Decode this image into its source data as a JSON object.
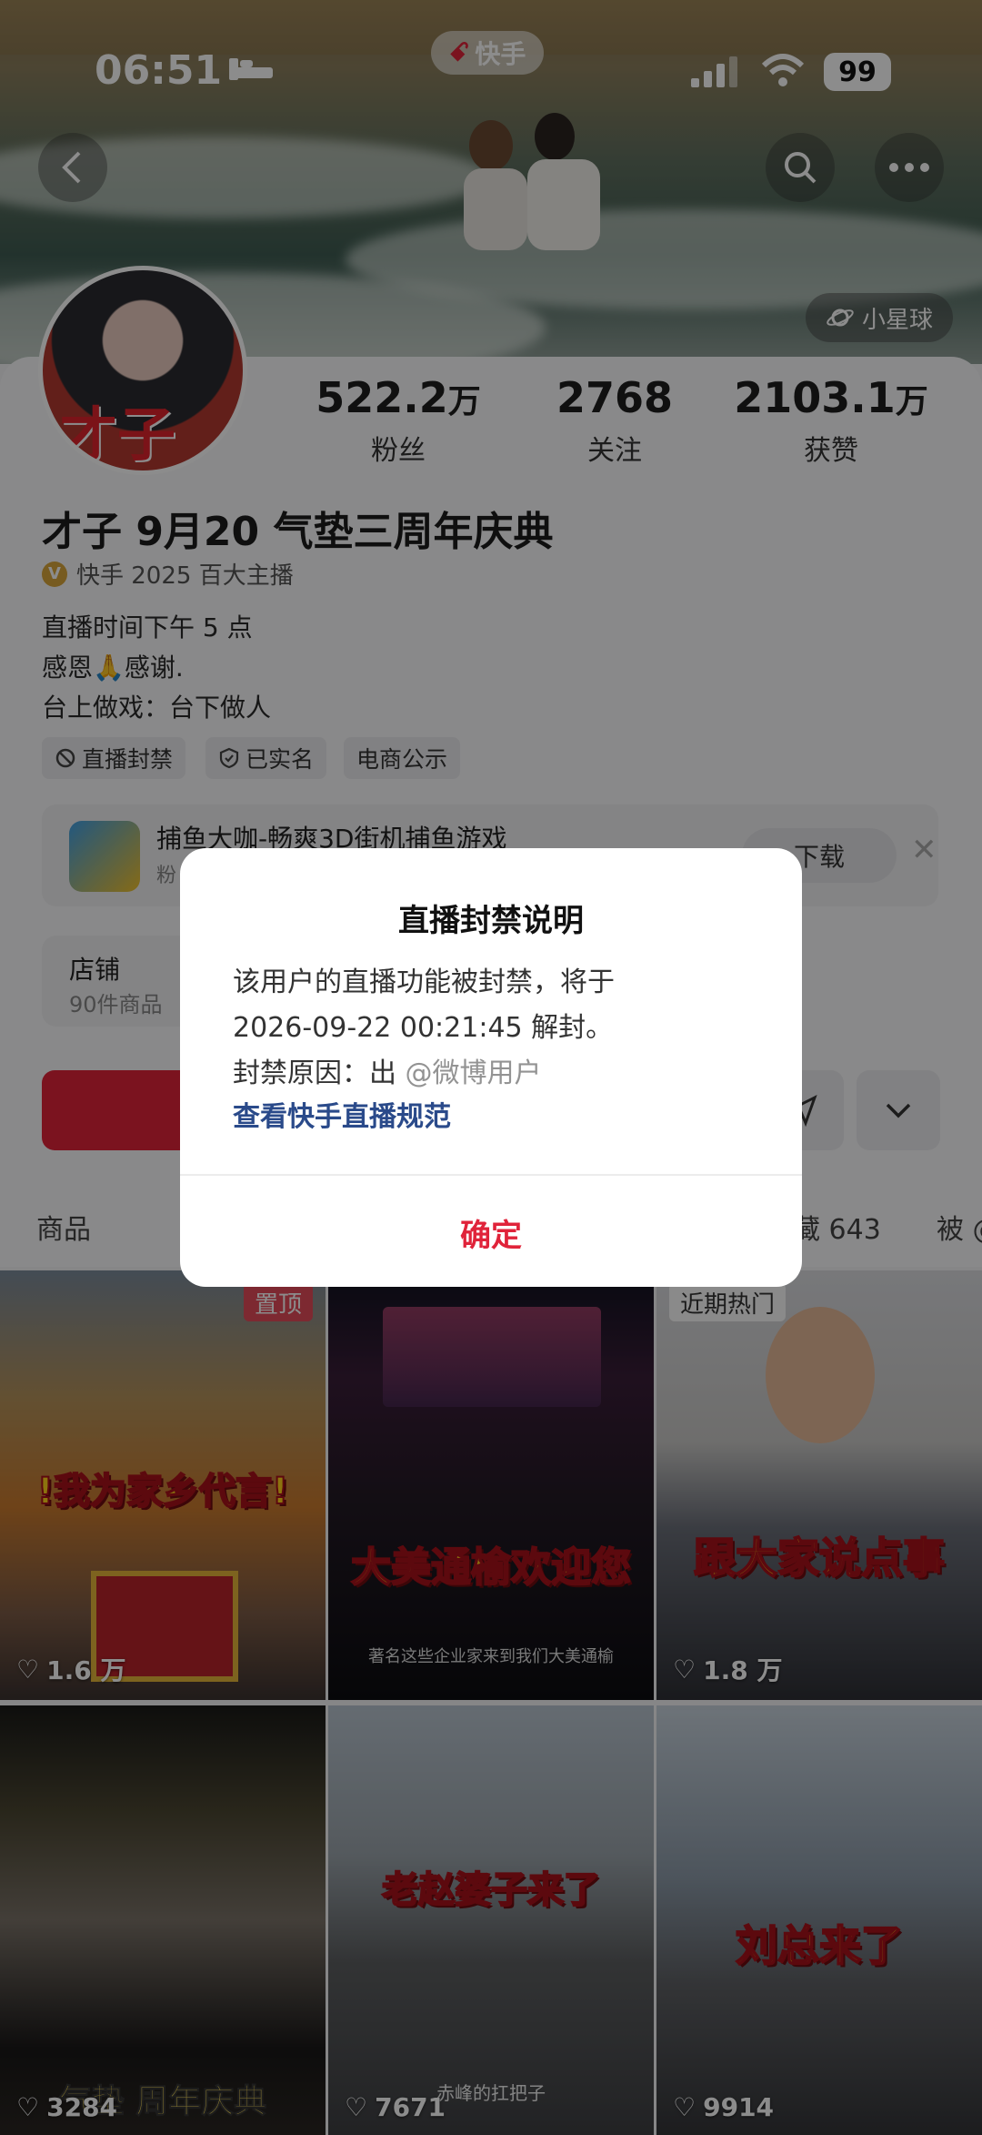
{
  "status_bar": {
    "time": "06:51",
    "battery": "99"
  },
  "app_badge": "快手",
  "planet_label": "小星球",
  "avatar_text": "才子",
  "stats": [
    {
      "num": "522.2",
      "unit": "万",
      "label": "粉丝"
    },
    {
      "num": "2768",
      "unit": "",
      "label": "关注"
    },
    {
      "num": "2103.1",
      "unit": "万",
      "label": "获赞"
    }
  ],
  "profile": {
    "name": "才子 9月20 气垫三周年庆典",
    "badge": "快手 2025 百大主播",
    "bio": [
      "直播时间下午 5 点",
      "感恩🙏感谢.",
      "台上做戏：台下做人"
    ],
    "tags": [
      "直播封禁",
      "已实名",
      "电商公示"
    ]
  },
  "game": {
    "title": "捕鱼大咖-畅爽3D街机捕鱼游戏",
    "sub": "粉",
    "button": "下载"
  },
  "shop": {
    "title": "店铺",
    "sub": "90件商品"
  },
  "tabs": {
    "products": "商品",
    "collect": "藏 643",
    "liked": "被 @"
  },
  "videos": [
    {
      "caption": "!我为家乡代言!",
      "likes": "1.6 万",
      "badge": "置顶"
    },
    {
      "caption": "大美通榆欢迎您",
      "likes": "",
      "subtitle": "著名这些企业家来到我们大美通榆"
    },
    {
      "caption": "跟大家说点事",
      "likes": "1.8 万",
      "badge": "近期热门"
    },
    {
      "caption": "气垫 周年庆典",
      "likes": "3284"
    },
    {
      "caption": "老赵婆子来了",
      "likes": "7671",
      "subtitle": "赤峰的扛把子"
    },
    {
      "caption": "刘总来了",
      "likes": "9914"
    }
  ],
  "dialog": {
    "title": "直播封禁说明",
    "line1": "该用户的直播功能被封禁，将于",
    "line2": "2026-09-22 00:21:45 解封。",
    "line3": "封禁原因：出",
    "watermark": "@微博用户",
    "link": "查看快手直播规范",
    "ok": "确定"
  },
  "colors": {
    "accent": "#e0233a",
    "link": "#2a4a8a",
    "gold": "#d9a63b"
  }
}
